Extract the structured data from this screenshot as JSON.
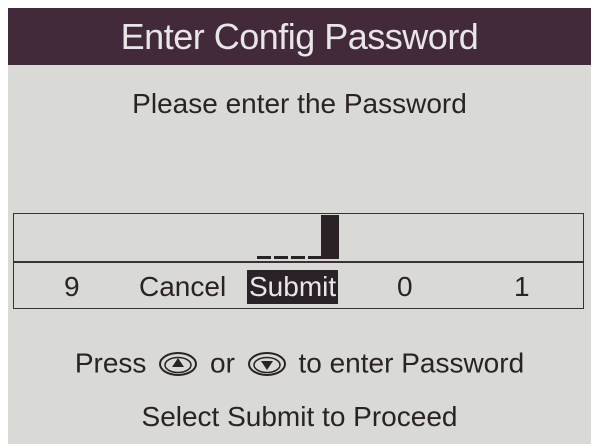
{
  "title": "Enter Config Password",
  "prompt": "Please enter the Password",
  "options": {
    "nine": "9",
    "cancel": "Cancel",
    "submit": "Submit",
    "zero": "0",
    "one": "1"
  },
  "instruction": {
    "press": "Press",
    "or": "or",
    "rest": "to enter Password",
    "up_icon": "up-arrow-button-icon",
    "down_icon": "down-arrow-button-icon"
  },
  "footer": "Select Submit to Proceed",
  "colors": {
    "title_bg": "#432a3b",
    "screen_bg": "#d9d9d5",
    "text": "#2a2226"
  }
}
